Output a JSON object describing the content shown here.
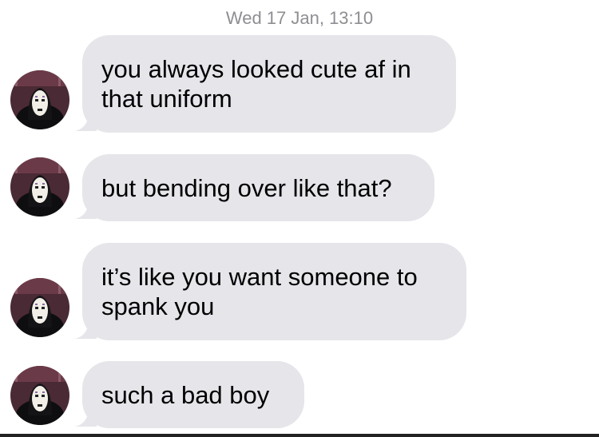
{
  "thread": {
    "timestamp": "Wed 17 Jan, 13:10"
  },
  "messages": [
    {
      "lines": [
        "you always looked cute af in",
        "that uniform"
      ],
      "avatar_icon": "no-face-avatar-icon"
    },
    {
      "lines": [
        "but bending over like that?"
      ],
      "avatar_icon": "no-face-avatar-icon"
    },
    {
      "lines": [
        "it’s like you want someone to",
        "spank you"
      ],
      "avatar_icon": "no-face-avatar-icon"
    },
    {
      "lines": [
        "such a bad boy"
      ],
      "avatar_icon": "no-face-avatar-icon"
    }
  ],
  "colors": {
    "incoming_bubble": "#e5e5ea",
    "timestamp_text": "#8e8e93",
    "message_text": "#000000"
  }
}
